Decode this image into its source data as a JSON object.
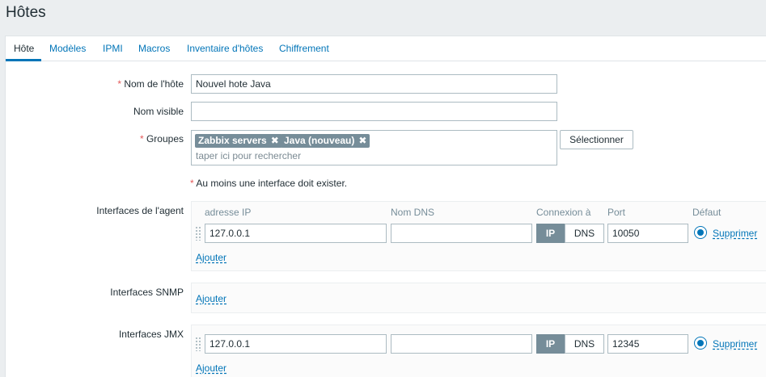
{
  "page": {
    "title": "Hôtes"
  },
  "tabs": [
    "Hôte",
    "Modèles",
    "IPMI",
    "Macros",
    "Inventaire d'hôtes",
    "Chiffrement"
  ],
  "form": {
    "required_mark": "*",
    "hostname": {
      "label": "Nom de l'hôte",
      "value": "Nouvel hote Java"
    },
    "visible_name": {
      "label": "Nom visible",
      "value": ""
    },
    "groups": {
      "label": "Groupes",
      "chips": [
        "Zabbix servers",
        "Java (nouveau)"
      ],
      "placeholder": "taper ici pour rechercher",
      "select_label": "Sélectionner"
    },
    "warning": "Au moins une interface doit exister."
  },
  "interfaces": {
    "columns": {
      "ip": "adresse IP",
      "dns": "Nom DNS",
      "connect": "Connexion à",
      "port": "Port",
      "default": "Défaut"
    },
    "agent": {
      "label": "Interfaces de l'agent",
      "row": {
        "ip": "127.0.0.1",
        "dns": "",
        "connect_ip": "IP",
        "connect_dns": "DNS",
        "port": "10050",
        "remove": "Supprimer"
      },
      "add": "Ajouter"
    },
    "snmp": {
      "label": "Interfaces SNMP",
      "add": "Ajouter"
    },
    "jmx": {
      "label": "Interfaces JMX",
      "row": {
        "ip": "127.0.0.1",
        "dns": "",
        "connect_ip": "IP",
        "connect_dns": "DNS",
        "port": "12345",
        "remove": "Supprimer"
      },
      "add": "Ajouter"
    }
  },
  "colors": {
    "accent": "#0275b8",
    "required": "#e45959",
    "chip": "#768d99"
  }
}
